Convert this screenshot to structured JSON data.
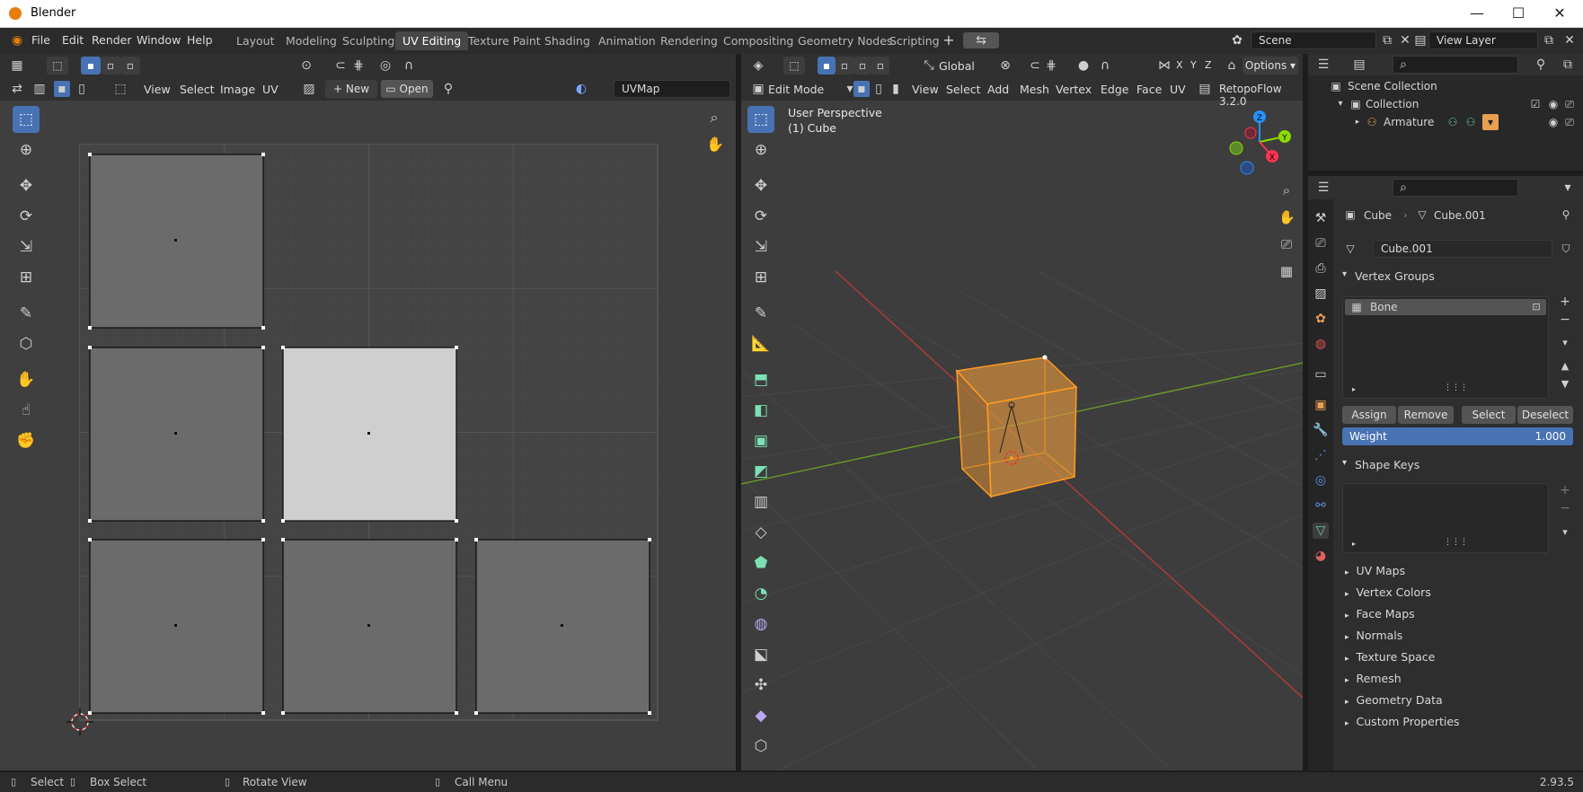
{
  "window": {
    "title": "Blender",
    "minimize": "—",
    "maximize": "☐",
    "close": "✕"
  },
  "menu": [
    "File",
    "Edit",
    "Render",
    "Window",
    "Help"
  ],
  "workspaces": [
    "Layout",
    "Modeling",
    "Sculpting",
    "UV Editing",
    "Texture Paint",
    "Shading",
    "Animation",
    "Rendering",
    "Compositing",
    "Geometry Nodes",
    "Scripting"
  ],
  "active_workspace": "UV Editing",
  "scene": {
    "name": "Scene",
    "view_layer": "View Layer"
  },
  "uv_editor": {
    "menus": [
      "View",
      "Select",
      "Image",
      "UV"
    ],
    "new_label": "New",
    "open_label": "Open",
    "uvmap": "UVMap"
  },
  "viewport": {
    "mode": "Edit Mode",
    "menus": [
      "View",
      "Select",
      "Add",
      "Mesh",
      "Vertex",
      "Edge",
      "Face",
      "UV"
    ],
    "addon": "RetopoFlow 3.2.0",
    "orientation": "Global",
    "options": "Options",
    "overlay_line1": "User Perspective",
    "overlay_line2": "(1) Cube",
    "axes": {
      "x": "X",
      "y": "Y",
      "z": "Z"
    }
  },
  "outliner": {
    "scene_collection": "Scene Collection",
    "collection": "Collection",
    "armature": "Armature"
  },
  "properties": {
    "object": "Cube",
    "mesh": "Cube.001",
    "mesh_field": "Cube.001",
    "vertex_groups_label": "Vertex Groups",
    "vertex_group_item": "Bone",
    "assign": "Assign",
    "remove": "Remove",
    "select": "Select",
    "deselect": "Deselect",
    "weight_label": "Weight",
    "weight_value": "1.000",
    "shape_keys_label": "Shape Keys",
    "collapsed_panels": [
      "UV Maps",
      "Vertex Colors",
      "Face Maps",
      "Normals",
      "Texture Space",
      "Remesh",
      "Geometry Data",
      "Custom Properties"
    ]
  },
  "statusbar": {
    "select": "Select",
    "box_select": "Box Select",
    "rotate_view": "Rotate View",
    "call_menu": "Call Menu",
    "version": "2.93.5"
  },
  "colors": {
    "accent": "#4772b3",
    "selection": "#ffa020",
    "x_axis": "#ff3352",
    "y_axis": "#8bdc00",
    "z_axis": "#2890ff"
  }
}
